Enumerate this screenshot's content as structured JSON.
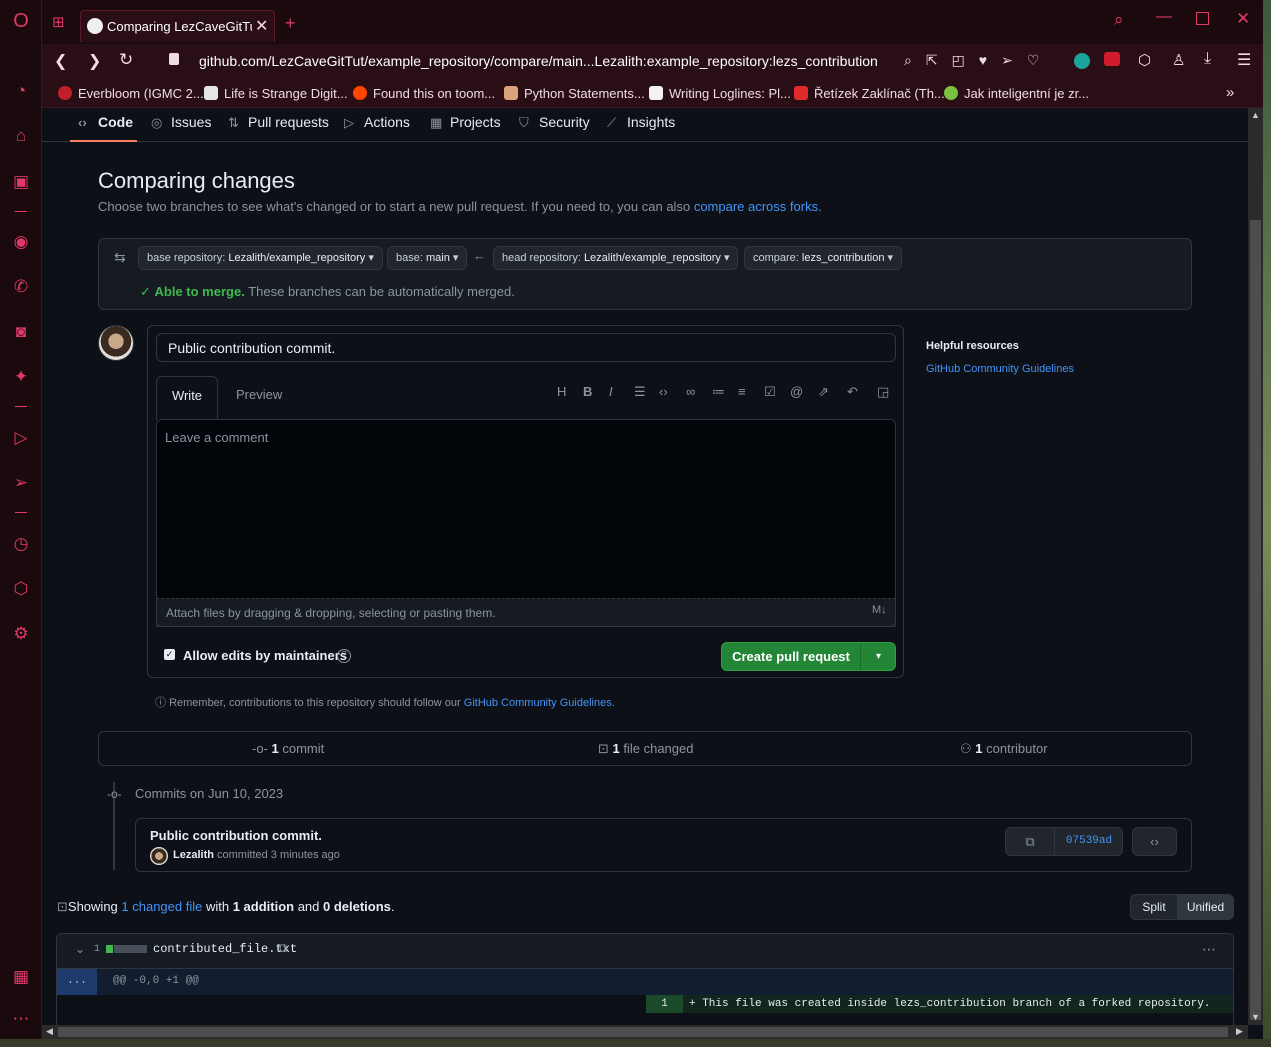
{
  "browser": {
    "tab_title": "Comparing LezCaveGitTut/",
    "url": "github.com/LezCaveGitTut/example_repository/compare/main...Lezalith:example_repository:lezs_contribution",
    "bookmarks": [
      {
        "label": "Everbloom (IGMC 2...",
        "color": "#c0202a"
      },
      {
        "label": "Life is Strange Digit...",
        "color": "#e6e6e6"
      },
      {
        "label": "Found this on toom...",
        "color": "#ff4500"
      },
      {
        "label": "Python Statements...",
        "color": "#d9a27a"
      },
      {
        "label": "Writing Loglines: Pl...",
        "color": "#f2f2f2"
      },
      {
        "label": "Řetízek Zaklínač (Th...",
        "color": "#e22a2a"
      },
      {
        "label": "Jak inteligentní je zr...",
        "color": "#7ac142"
      }
    ]
  },
  "repo_nav": {
    "code": "Code",
    "issues": "Issues",
    "pull_requests": "Pull requests",
    "actions": "Actions",
    "projects": "Projects",
    "security": "Security",
    "insights": "Insights"
  },
  "compare": {
    "title": "Comparing changes",
    "subtitle": "Choose two branches to see what's changed or to start a new pull request. If you need to, you can also",
    "subtitle_link": "compare across forks.",
    "base_repo_prefix": "base repository: ",
    "base_repo": "Lezalith/example_repository",
    "base_prefix": "base: ",
    "base": "main",
    "head_repo_prefix": "head repository: ",
    "head_repo": "Lezalith/example_repository",
    "compare_prefix": "compare: ",
    "compare": "lezs_contribution",
    "merge_status": "Able to merge.",
    "merge_detail": "These branches can be automatically merged."
  },
  "pr_form": {
    "title_value": "Public contribution commit.",
    "tab_write": "Write",
    "tab_preview": "Preview",
    "comment_placeholder": "Leave a comment",
    "attach_hint": "Attach files by dragging & dropping, selecting or pasting them.",
    "allow_edits": "Allow edits by maintainers",
    "create_button": "Create pull request",
    "reminder": "Remember, contributions to this repository should follow our",
    "reminder_link": "GitHub Community Guidelines."
  },
  "helpful": {
    "heading": "Helpful resources",
    "link": "GitHub Community Guidelines"
  },
  "summary": {
    "commits_count": "1",
    "commits_label": " commit",
    "files_count": "1",
    "files_label": " file changed",
    "contributors_count": "1",
    "contributors_label": " contributor"
  },
  "commits": {
    "date_heading": "Commits on Jun 10, 2023",
    "message": "Public contribution commit.",
    "author": "Lezalith",
    "meta": " committed 3 minutes ago",
    "sha": "07539ad"
  },
  "diff": {
    "showing": "Showing ",
    "changed_link": "1 changed file",
    "with": " with ",
    "additions": "1 addition",
    "and": " and ",
    "deletions": "0 deletions",
    "period": ".",
    "split": "Split",
    "unified": "Unified",
    "file_count": "1",
    "filename": "contributed_file.txt",
    "expand": "...",
    "hunk": "@@ -0,0 +1 @@",
    "line_no": "1",
    "line": "+ This file was created inside lezs_contribution branch of a forked repository."
  }
}
